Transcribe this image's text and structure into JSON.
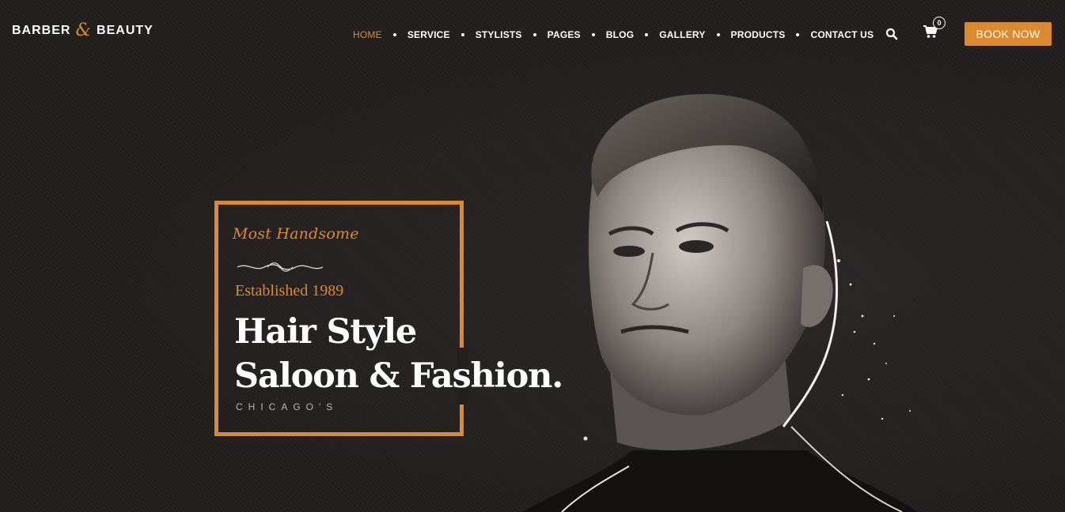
{
  "brand": {
    "logo_left": "BARBER",
    "logo_amp": "&",
    "logo_right": "BEAUTY"
  },
  "nav": {
    "items": [
      {
        "label": "HOME",
        "active": true
      },
      {
        "label": "SERVICE",
        "active": false
      },
      {
        "label": "STYLISTS",
        "active": false
      },
      {
        "label": "PAGES",
        "active": false
      },
      {
        "label": "BLOG",
        "active": false
      },
      {
        "label": "GALLERY",
        "active": false
      },
      {
        "label": "PRODUCTS",
        "active": false
      },
      {
        "label": "CONTACT US",
        "active": false
      }
    ]
  },
  "header_actions": {
    "search_icon": "search-icon",
    "cart_icon": "cart-icon",
    "cart_count": "0",
    "book_label": "BOOK NOW"
  },
  "hero": {
    "script_text": "Most Handsome",
    "established": "Established 1989",
    "headline_line1": "Hair Style",
    "headline_line2": "Saloon & Fashion.",
    "city": "CHICAGO'S"
  },
  "colors": {
    "accent": "#dc8a2f",
    "background": "#231f1f",
    "text": "#ffffff"
  }
}
